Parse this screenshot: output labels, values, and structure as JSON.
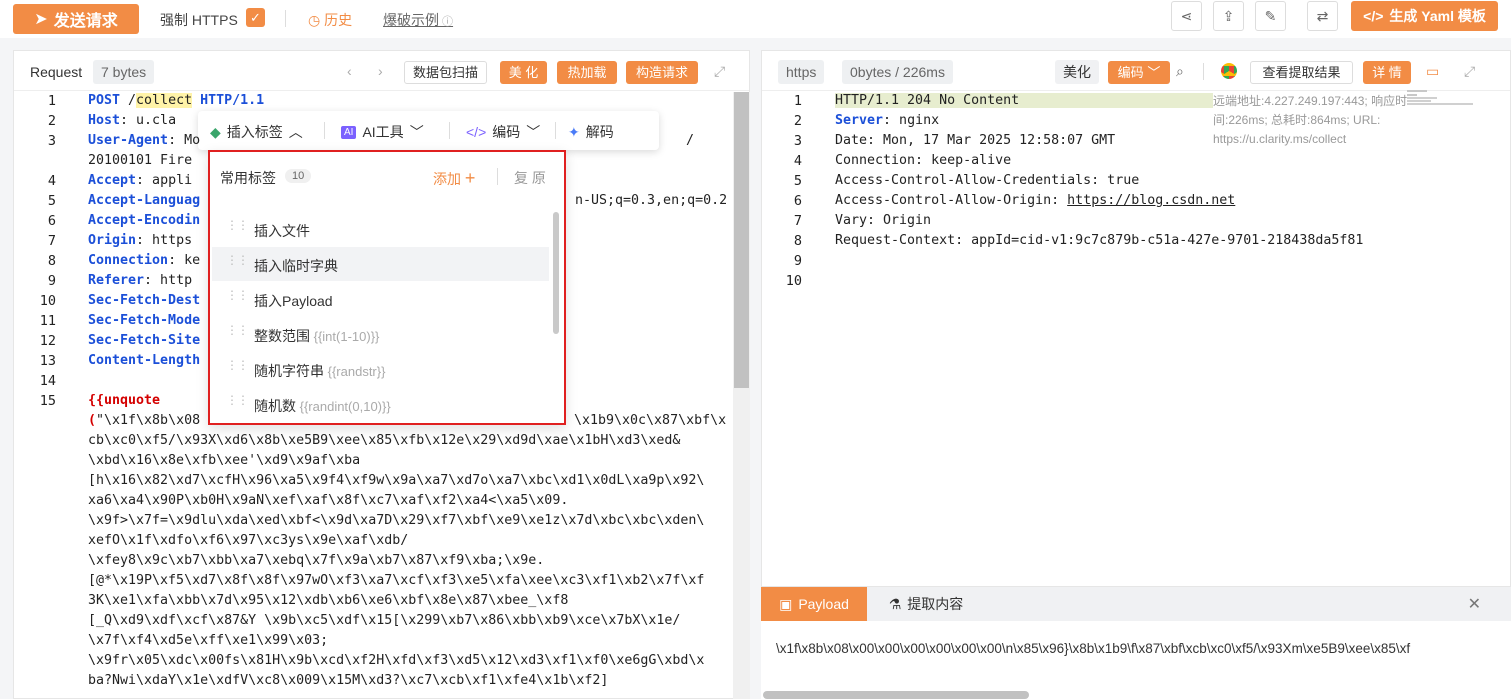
{
  "toolbar": {
    "send_label": "发送请求",
    "force_https_label": "强制 HTTPS",
    "history_label": "历史",
    "brute_example_label": "爆破示例",
    "yaml_label": "生成 Yaml 模板"
  },
  "request": {
    "title": "Request",
    "size": "7 bytes",
    "btn_scan": "数据包扫描",
    "btn_beautify": "美 化",
    "btn_hotload": "热加载",
    "btn_construct": "构造请求",
    "lines": [
      {
        "n": "1",
        "method": "POST",
        "sp": " /",
        "path": "collect",
        "rest": " HTTP/1.1"
      },
      {
        "n": "2",
        "key": "Host",
        "rest": ": u.cla"
      },
      {
        "n": "3",
        "key": "User-Agent",
        "rest": ": Mo",
        "tail": "/"
      },
      {
        "n": "",
        "rest": "20100101 Fire"
      },
      {
        "n": "4",
        "key": "Accept",
        "rest": ": appli"
      },
      {
        "n": "5",
        "key": "Accept-Languag",
        "tail": "n-US;q=0.3,en;q=0.2"
      },
      {
        "n": "6",
        "key": "Accept-Encodin"
      },
      {
        "n": "7",
        "key": "Origin",
        "rest": ": https"
      },
      {
        "n": "8",
        "key": "Connection",
        "rest": ": ke"
      },
      {
        "n": "9",
        "key": "Referer",
        "rest": ": http"
      },
      {
        "n": "10",
        "key": "Sec-Fetch-Dest"
      },
      {
        "n": "11",
        "key": "Sec-Fetch-Mode"
      },
      {
        "n": "12",
        "key": "Sec-Fetch-Site"
      },
      {
        "n": "13",
        "key": "Content-Length"
      },
      {
        "n": "14"
      },
      {
        "n": "15",
        "red": "{{unquote"
      },
      {
        "n": "",
        "red": "(",
        "rest": "\"\\x1f\\x8b\\x08",
        "tail": "\\x1b9\\x0c\\x87\\xbf\\x"
      },
      {
        "n": "",
        "rest": "cb\\xc0\\xf5/\\x93X\\xd6\\x8b\\xe5B9\\xee\\x85\\xfb\\x12e\\x29\\xd9d\\xae\\x1bH\\xd3\\xed&"
      },
      {
        "n": "",
        "rest": "\\xbd\\x16\\x8e\\xfb\\xee'\\xd9\\x9af\\xba"
      },
      {
        "n": "",
        "rest": "[h\\x16\\x82\\xd7\\xcfH\\x96\\xa5\\x9f4\\xf9w\\x9a\\xa7\\xd7o\\xa7\\xbc\\xd1\\x0dL\\xa9p\\x92\\"
      },
      {
        "n": "",
        "rest": "xa6\\xa4\\x90P\\xb0H\\x9aN\\xef\\xaf\\x8f\\xc7\\xaf\\xf2\\xa4<\\xa5\\x09."
      },
      {
        "n": "",
        "rest": "\\x9f>\\x7f=\\x9dlu\\xda\\xed\\xbf<\\x9d\\xa7D\\x29\\xf7\\xbf\\xe9\\xe1z\\x7d\\xbc\\xbc\\xden\\"
      },
      {
        "n": "",
        "rest": "xefO\\x1f\\xdfo\\xf6\\x97\\xc3ys\\x9e\\xaf\\xdb/"
      },
      {
        "n": "",
        "rest": "\\xfey8\\x9c\\xb7\\xbb\\xa7\\xebq\\x7f\\x9a\\xb7\\x87\\xf9\\xba;\\x9e."
      },
      {
        "n": "",
        "rest": "[@*\\x19P\\xf5\\xd7\\x8f\\x8f\\x97wO\\xf3\\xa7\\xcf\\xf3\\xe5\\xfa\\xee\\xc3\\xf1\\xb2\\x7f\\xf"
      },
      {
        "n": "",
        "rest": "3K\\xe1\\xfa\\xbb\\x7d\\x95\\x12\\xdb\\xb6\\xe6\\xbf\\x8e\\x87\\xbee_\\xf8"
      },
      {
        "n": "",
        "rest": "[_Q\\xd9\\xdf\\xcf\\x87&Y \\x9b\\xc5\\xdf\\x15[\\x299\\xb7\\x86\\xbb\\xb9\\xce\\x7bX\\x1e/"
      },
      {
        "n": "",
        "rest": "\\x7f\\xf4\\xd5e\\xff\\xe1\\x99\\x03;"
      },
      {
        "n": "",
        "rest": "\\x9fr\\x05\\xdc\\x00fs\\x81H\\x9b\\xcd\\xf2H\\xfd\\xf3\\xd5\\x12\\xd3\\xf1\\xf0\\xe6gG\\xbd\\x"
      },
      {
        "n": "",
        "rest": "ba?Nwi\\xdaY\\x1e\\xdfV\\xc8\\x009\\x15M\\xd3?\\xc7\\xcb\\xf1\\xfe4\\x1b\\xf2]"
      }
    ]
  },
  "popup": {
    "insert_tag": "插入标签",
    "ai_tool": "AI工具",
    "encode": "编码",
    "decode": "解码"
  },
  "tags": {
    "title": "常用标签",
    "count": "10",
    "add": "添加",
    "reset": "复 原",
    "items": [
      {
        "label": "插入文件",
        "hint": ""
      },
      {
        "label": "插入临时字典",
        "hint": ""
      },
      {
        "label": "插入Payload",
        "hint": ""
      },
      {
        "label": "整数范围",
        "hint": "{{int(1-10)}}"
      },
      {
        "label": "随机字符串",
        "hint": "{{randstr}}"
      },
      {
        "label": "随机数",
        "hint": "{{randint(0,10)}}"
      }
    ]
  },
  "response": {
    "scheme": "https",
    "stats": "0bytes / 226ms",
    "btn_beautify": "美化",
    "btn_encode": "编码",
    "btn_extract": "查看提取结果",
    "btn_detail": "详 情",
    "remote_note": "远端地址:4.227.249.197:443; 响应时间:226ms; 总耗时:864ms; URL: https://u.clarity.ms/collect",
    "lines": [
      {
        "n": "1",
        "text": "HTTP/1.1 204 No Content"
      },
      {
        "n": "2",
        "key": "Server",
        "rest": ": nginx"
      },
      {
        "n": "3",
        "rest": "Date: Mon, 17 Mar 2025 12:58:07 GMT"
      },
      {
        "n": "4",
        "rest": "Connection: keep-alive"
      },
      {
        "n": "5",
        "rest": "Access-Control-Allow-Credentials: true"
      },
      {
        "n": "6",
        "rest": "Access-Control-Allow-Origin: ",
        "link": "https://blog.csdn.net"
      },
      {
        "n": "7",
        "rest": "Vary: Origin"
      },
      {
        "n": "8",
        "rest": "Request-Context: appId=cid-v1:9c7c879b-c51a-427e-9701-218438da5f81"
      },
      {
        "n": "9"
      },
      {
        "n": "10"
      }
    ]
  },
  "bottom": {
    "tab_payload": "Payload",
    "tab_extract": "提取内容",
    "payload_text": "\\x1f\\x8b\\x08\\x00\\x00\\x00\\x00\\x00\\x00\\n\\x85\\x96}\\x8b\\x1b9\\f\\x87\\xbf\\xcb\\xc0\\xf5/\\x93Xm\\xe5B9\\xee\\x85\\xf"
  },
  "colors": {
    "accent": "#f28c45",
    "keyword": "#1b4fd8",
    "highlight_border": "#e02020"
  }
}
